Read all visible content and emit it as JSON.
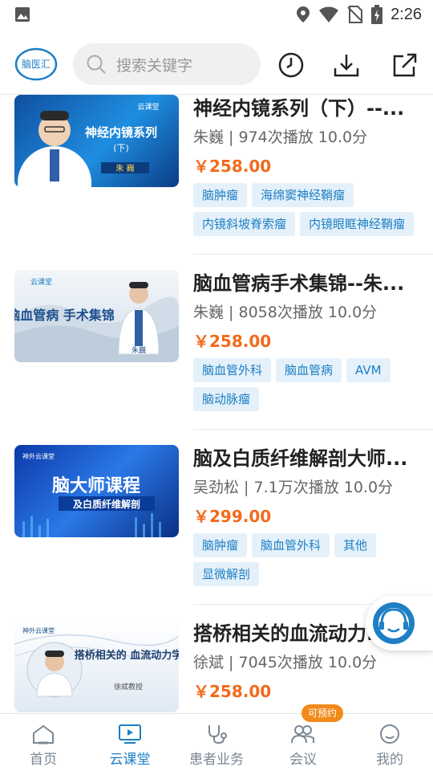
{
  "status_bar": {
    "time": "2:26"
  },
  "header": {
    "logo_text": "脑医汇",
    "search_placeholder": "搜索关键字"
  },
  "courses": [
    {
      "title": "神经内镜系列（下）--...",
      "meta": "朱巍 | 974次播放  10.0分",
      "price": "￥258.00",
      "tags": [
        "脑肿瘤",
        "海绵窦神经鞘瘤",
        "内镜斜坡脊索瘤",
        "内镜眼眶神经鞘瘤"
      ],
      "thumb_text": "神经内镜系列",
      "thumb_sub": "(下)",
      "thumb_badge": "云课堂",
      "thumb_name": "朱 巍"
    },
    {
      "title": "脑血管病手术集锦--朱...",
      "meta": "朱巍 | 8058次播放  10.0分",
      "price": "￥258.00",
      "tags": [
        "脑血管外科",
        "脑血管病",
        "AVM",
        "脑动脉瘤"
      ],
      "thumb_text": "脑血管病 手术集锦",
      "thumb_badge": "云课堂",
      "thumb_name": "朱巍"
    },
    {
      "title": "脑及白质纤维解剖大师...",
      "meta": "吴劲松 | 7.1万次播放  10.0分",
      "price": "￥299.00",
      "tags": [
        "脑肿瘤",
        "脑血管外科",
        "其他",
        "显微解剖"
      ],
      "thumb_text": "脑大师课程",
      "thumb_sub": "及白质纤维解剖",
      "thumb_badge": "神外云课堂"
    },
    {
      "title": "搭桥相关的血流动力...",
      "meta": "徐斌 | 7045次播放  10.0分",
      "price": "￥258.00",
      "tags": [],
      "thumb_text": "搭桥相关的 血流动力学",
      "thumb_sub": "徐斌教授",
      "thumb_badge": "神外云课堂"
    }
  ],
  "bottom_nav": [
    {
      "label": "首页",
      "icon": "home-icon",
      "active": false
    },
    {
      "label": "云课堂",
      "icon": "video-icon",
      "active": true
    },
    {
      "label": "患者业务",
      "icon": "stethoscope-icon",
      "active": false
    },
    {
      "label": "会议",
      "icon": "meeting-icon",
      "active": false,
      "badge": "可预约"
    },
    {
      "label": "我的",
      "icon": "profile-icon",
      "active": false
    }
  ],
  "colors": {
    "accent": "#1d7fc4",
    "price": "#f26a1b",
    "tag_bg": "#e5f1fa",
    "badge": "#f28a1b"
  }
}
